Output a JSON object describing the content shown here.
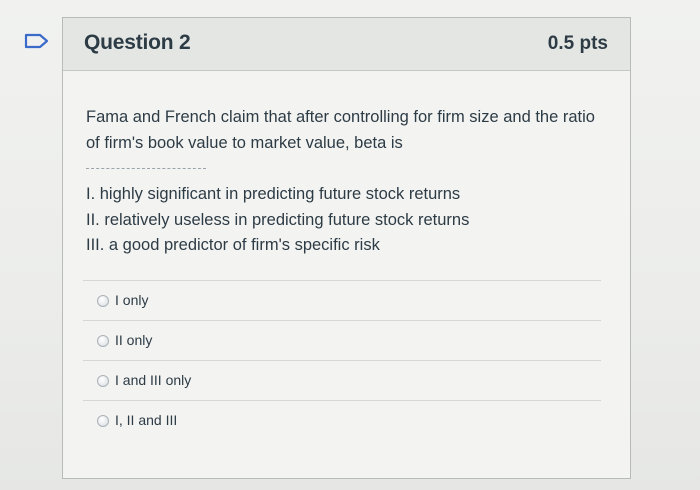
{
  "question": {
    "title": "Question 2",
    "points": "0.5 pts",
    "text": "Fama and French claim that after controlling for firm size and the ratio of firm's book value to market value, beta is",
    "statements": [
      "I. highly significant in predicting future stock returns",
      "II. relatively useless in predicting future stock returns",
      "III. a good predictor of firm's specific risk"
    ]
  },
  "answers": [
    {
      "label": "I only"
    },
    {
      "label": "II only"
    },
    {
      "label": "I and III only"
    },
    {
      "label": "I, II and III"
    }
  ]
}
